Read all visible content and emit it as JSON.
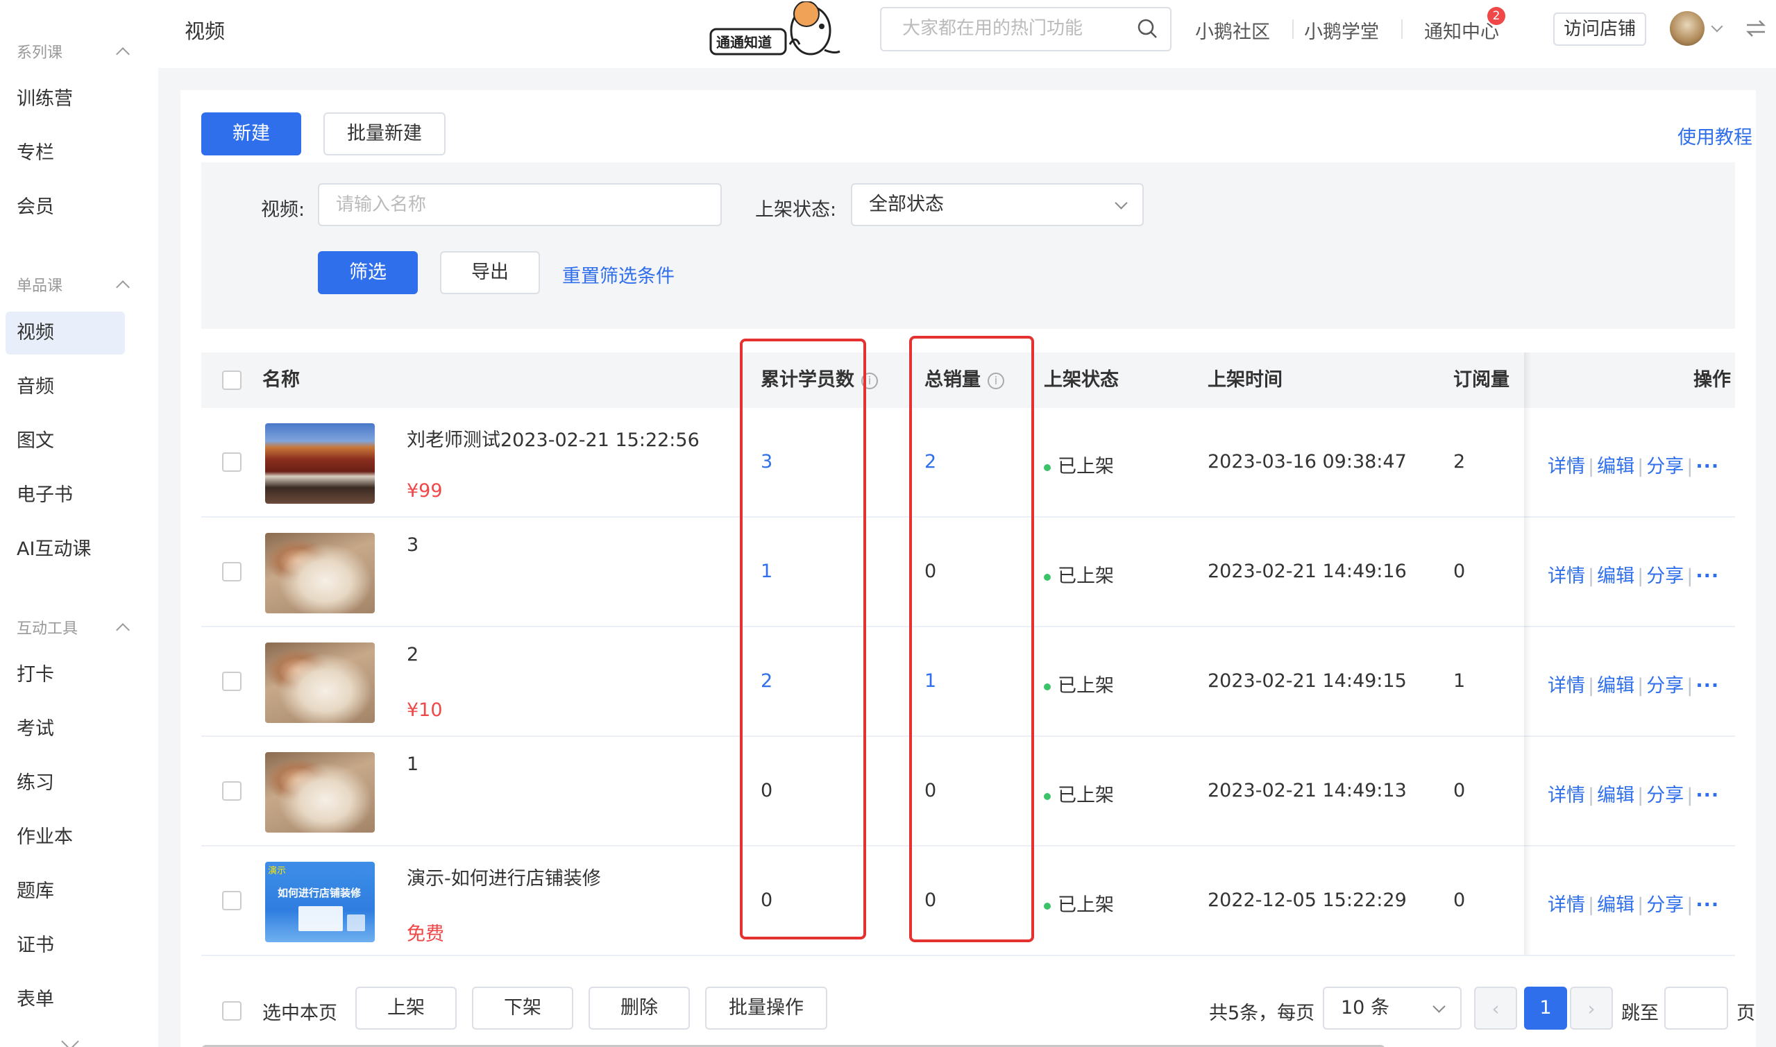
{
  "sidebar": {
    "groups": [
      {
        "title": "系列课",
        "items": [
          "训练营",
          "专栏",
          "会员"
        ]
      },
      {
        "title": "单品课",
        "items": [
          "视频",
          "音频",
          "图文",
          "电子书",
          "AI互动课"
        ]
      },
      {
        "title": "互动工具",
        "items": [
          "打卡",
          "考试",
          "练习",
          "作业本",
          "题库",
          "证书",
          "表单"
        ]
      }
    ],
    "active_item": "视频"
  },
  "header": {
    "page_title": "视频",
    "logo_text": "通通知道",
    "search_placeholder": "大家都在用的热门功能",
    "links": [
      "小鹅社区",
      "小鹅学堂",
      "通知中心"
    ],
    "notification_count": "2",
    "visit_store_label": "访问店铺"
  },
  "toolbar": {
    "new_label": "新建",
    "batch_new_label": "批量新建",
    "tutorial_label": "使用教程"
  },
  "filter": {
    "video_label": "视频:",
    "video_placeholder": "请输入名称",
    "status_label": "上架状态:",
    "status_value": "全部状态",
    "filter_label": "筛选",
    "export_label": "导出",
    "reset_label": "重置筛选条件"
  },
  "table": {
    "columns": {
      "name": "名称",
      "students": "累计学员数",
      "sales": "总销量",
      "status": "上架状态",
      "time": "上架时间",
      "subs": "订阅量",
      "ops": "操作"
    },
    "rows": [
      {
        "name": "刘老师测试2023-02-21 15:22:56",
        "price": "¥99",
        "students": "3",
        "sales": "2",
        "status": "已上架",
        "time": "2023-03-16 09:38:47",
        "subs": "2"
      },
      {
        "name": "3",
        "price": "",
        "students": "1",
        "sales": "0",
        "status": "已上架",
        "time": "2023-02-21 14:49:16",
        "subs": "0"
      },
      {
        "name": "2",
        "price": "¥10",
        "students": "2",
        "sales": "1",
        "status": "已上架",
        "time": "2023-02-21 14:49:15",
        "subs": "1"
      },
      {
        "name": "1",
        "price": "",
        "students": "0",
        "sales": "0",
        "status": "已上架",
        "time": "2023-02-21 14:49:13",
        "subs": "0"
      },
      {
        "name": "演示-如何进行店铺装修",
        "price": "免费",
        "students": "0",
        "sales": "0",
        "status": "已上架",
        "time": "2022-12-05 15:22:29",
        "subs": "0"
      }
    ],
    "ops": {
      "detail": "详情",
      "edit": "编辑",
      "share": "分享",
      "more": "···"
    },
    "thumb_demo": {
      "tag": "演示",
      "title": "如何进行店铺装修"
    }
  },
  "footer": {
    "select_page_label": "选中本页",
    "on_shelf_label": "上架",
    "off_shelf_label": "下架",
    "delete_label": "删除",
    "batch_label": "批量操作",
    "total_text": "共5条，每页",
    "page_size": "10 条",
    "current_page": "1",
    "jump_label": "跳至",
    "page_unit": "页"
  },
  "colors": {
    "primary": "#2f6fec",
    "danger": "#f04848",
    "status_green": "#3cc36a",
    "highlight_box": "#e3322f"
  }
}
